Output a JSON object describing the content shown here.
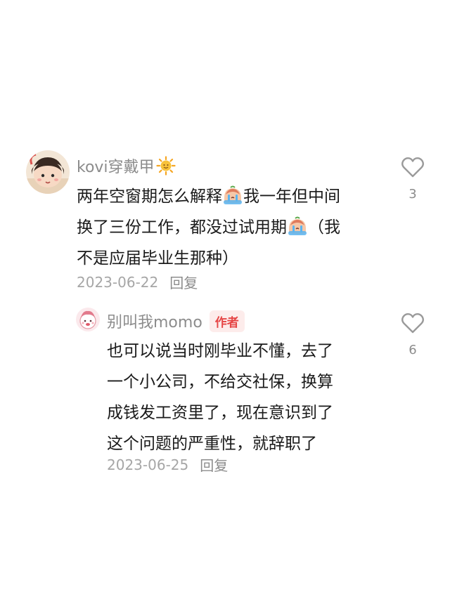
{
  "main_comment": {
    "username": "kovi穿戴甲",
    "username_emoji_icon": "sun-emoji-icon",
    "body_lines": [
      {
        "before": "两年空窗期怎么解释",
        "after": "我一年但中间"
      },
      {
        "before": "换了三份工作，都没过试用期",
        "after": "（我"
      },
      {
        "text": "不是应届毕业生那种）"
      }
    ],
    "date": "2023-06-22",
    "reply_label": "回复",
    "like_count": "3"
  },
  "reply_comment": {
    "username": "别叫我momo",
    "author_tag": "作者",
    "body_lines": [
      "也可以说当时刚毕业不懂，去了",
      "一个小公司，不给交社保，换算",
      "成钱发工资里了，现在意识到了",
      "这个问题的严重性，就辞职了"
    ],
    "date": "2023-06-25",
    "reply_label": "回复",
    "like_count": "6"
  },
  "colors": {
    "username": "#8c8c8c",
    "meta": "#a6a6a6",
    "author_tag_bg": "#fdeceb",
    "author_tag_text": "#e64545",
    "body": "#1a1a1a"
  }
}
